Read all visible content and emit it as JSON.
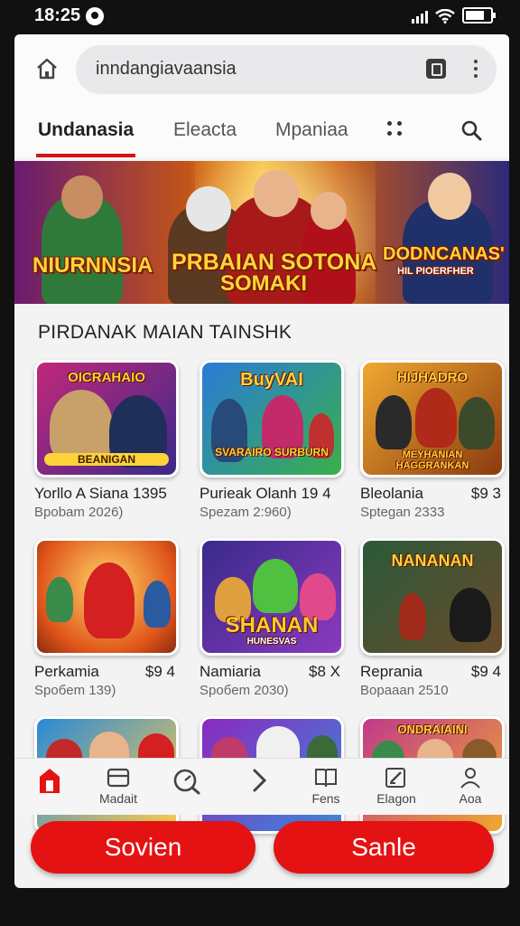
{
  "status": {
    "time": "18:25"
  },
  "browser": {
    "url": "inndangiavaansia"
  },
  "nav": {
    "tabs": [
      {
        "label": "Undanasia",
        "active": true
      },
      {
        "label": "Eleacta",
        "active": false
      },
      {
        "label": "Mpaniaa",
        "active": false
      }
    ]
  },
  "banner": {
    "left_text": "NIURNNSIA",
    "center_text_1": "PRBAIAN SOTONA",
    "center_text_2": "SOMAKI",
    "right_text_1": "DODNCANAS'",
    "right_text_2": "HIL PIOERFHER"
  },
  "section": {
    "title": "PIRDANAK MAIAN TAINSHK"
  },
  "games": [
    {
      "logo_top": "OICRAHAIO",
      "logo_bottom": "BEANIGAN",
      "title": "Yorllo A Siana 1395",
      "price": "",
      "sub": "Bpobam 2026)"
    },
    {
      "logo_top": "BuyVAI",
      "logo_bottom": "SVARAIRO SURBURN",
      "title": "Purieak Olanh 19 4",
      "price": "",
      "sub": "Spezam 2:960)"
    },
    {
      "logo_top": "HIJHADRO",
      "logo_bottom": "MEYHANIAN HAGGRANKAN",
      "title": "Bleolania",
      "price": "$9 3",
      "sub": "Sptegan 2333"
    },
    {
      "logo_top": "",
      "logo_bottom": "",
      "title": "Perkamia",
      "price": "$9 4",
      "sub": "Spoбem 139)"
    },
    {
      "logo_top": "",
      "logo_bottom": "SHANAN",
      "logo_sub": "HUNESVAS",
      "title": "Namiaria",
      "price": "$8 X",
      "sub": "Spoбem 2030)"
    },
    {
      "logo_top": "NANANAN",
      "logo_bottom": "",
      "title": "Reprania",
      "price": "$9 4",
      "sub": "Bopaaan 2510"
    },
    {
      "logo_top": "",
      "logo_bottom": "",
      "title": "",
      "price": "",
      "sub": ""
    },
    {
      "logo_top": "",
      "logo_bottom": "",
      "title": "",
      "price": "",
      "sub": ""
    },
    {
      "logo_top": "ONDRAIAINI",
      "logo_bottom": "",
      "title": "",
      "price": "",
      "sub": ""
    }
  ],
  "bottom_nav": {
    "items": [
      {
        "label": "",
        "icon": "home-icon"
      },
      {
        "label": "Madait",
        "icon": "card-icon"
      },
      {
        "label": "",
        "icon": "search-icon"
      },
      {
        "label": "",
        "icon": "chevron-right-icon"
      },
      {
        "label": "Fens",
        "icon": "book-icon"
      },
      {
        "label": "Elagon",
        "icon": "edit-icon"
      },
      {
        "label": "Aoa",
        "icon": "person-icon"
      }
    ]
  },
  "actions": {
    "left": "Sovien",
    "right": "Sanle"
  },
  "colors": {
    "accent": "#e41212",
    "screen_bg": "#f3f3f4"
  }
}
